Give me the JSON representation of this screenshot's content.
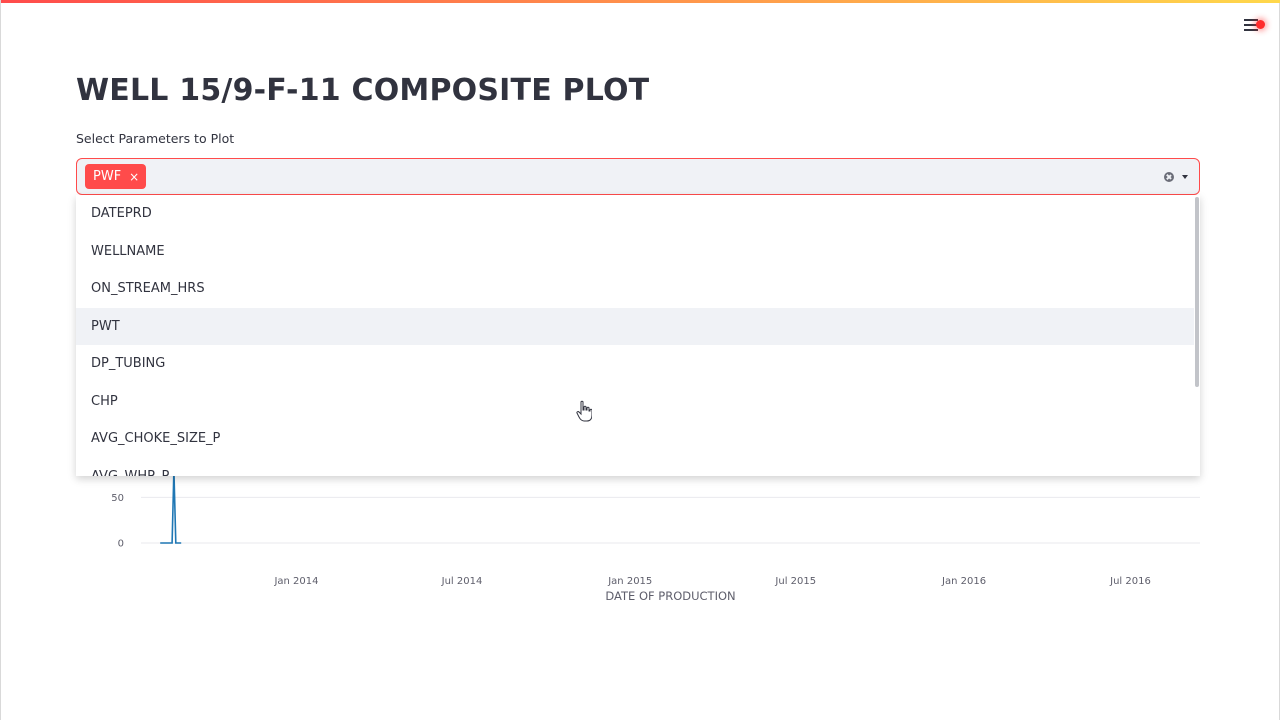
{
  "header": {
    "title": "WELL 15/9-F-11 COMPOSITE PLOT",
    "menu_icon": "hamburger-menu-icon"
  },
  "params_select": {
    "label": "Select Parameters to Plot",
    "selected": [
      {
        "label": "PWF",
        "remove": "×"
      }
    ],
    "options": [
      "DATEPRD",
      "WELLNAME",
      "ON_STREAM_HRS",
      "PWT",
      "DP_TUBING",
      "CHP",
      "AVG_CHOKE_SIZE_P",
      "AVG_WHP_P"
    ],
    "hovered_option": "PWT"
  },
  "colors": {
    "accent": "#ff4b4b",
    "line": "#1f77b4",
    "text": "#31333f"
  },
  "chart_data": {
    "type": "line",
    "xlabel": "DATE OF PRODUCTION",
    "x_ticks": [
      "Jan 2014",
      "Jul 2014",
      "Jan 2015",
      "Jul 2015",
      "Jan 2016",
      "Jul 2016"
    ],
    "y_ticks": [
      0,
      50
    ],
    "xlim": [
      "2013-07-15",
      "2016-09-15"
    ],
    "ylim": [
      0,
      80
    ],
    "series": [
      {
        "x": [
          "2013-08-05",
          "2013-08-08",
          "2013-08-10",
          "2013-08-12",
          "2013-08-14",
          "2013-08-16",
          "2013-08-18",
          "2013-08-20",
          "2013-08-22",
          "2013-08-24",
          "2013-08-28"
        ],
        "y": [
          0,
          0,
          0,
          0,
          0,
          0,
          0,
          80,
          0,
          0,
          0
        ]
      }
    ]
  }
}
